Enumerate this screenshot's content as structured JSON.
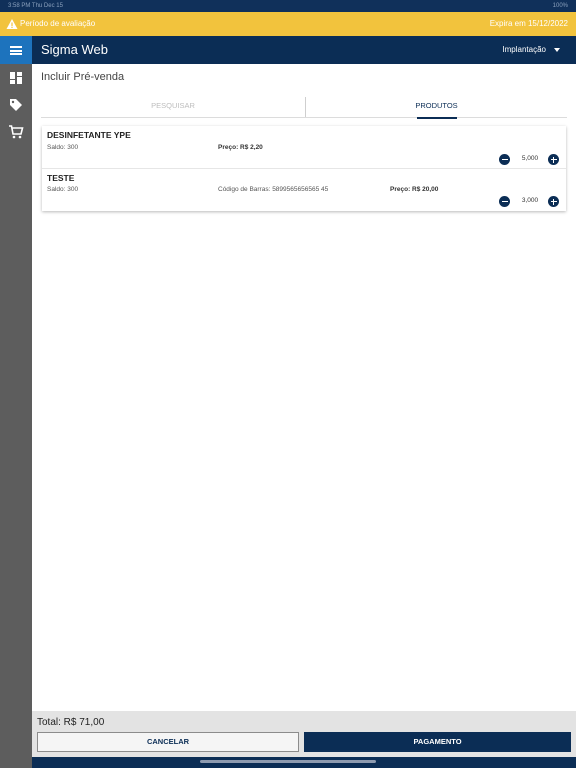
{
  "status_bar": {
    "time": "3:58 PM   Thu Dec 15",
    "battery": "100%"
  },
  "trial_banner": {
    "message": "Período de avaliação",
    "expires": "Expira em 15/12/2022"
  },
  "sidebar": {
    "icons": [
      "menu-icon",
      "dashboard-icon",
      "tag-icon",
      "cart-icon"
    ]
  },
  "header": {
    "app_name": "Sigma Web",
    "unit": "Implantação"
  },
  "page": {
    "title": "Incluir Pré-venda"
  },
  "tabs": [
    {
      "label": "PESQUISAR"
    },
    {
      "label": "PRODUTOS"
    }
  ],
  "products": [
    {
      "name": "DESINFETANTE YPE",
      "stock": "Saldo: 300",
      "barcode": "",
      "price": "Preço: R$ 2,20",
      "quantity": "5,000"
    },
    {
      "name": "TESTE",
      "stock": "Saldo: 300",
      "barcode": "Código de Barras: 5899565656565 45",
      "price": "Preço: R$ 20,00",
      "quantity": "3,000"
    }
  ],
  "footer": {
    "total": "Total: R$ 71,00",
    "cancel_label": "CANCELAR",
    "pay_label": "PAGAMENTO"
  },
  "colors": {
    "primary": "#0b2d55",
    "menu_active": "#1d73bd",
    "banner": "#f2c33d",
    "sidebar": "#5d5d5d"
  }
}
